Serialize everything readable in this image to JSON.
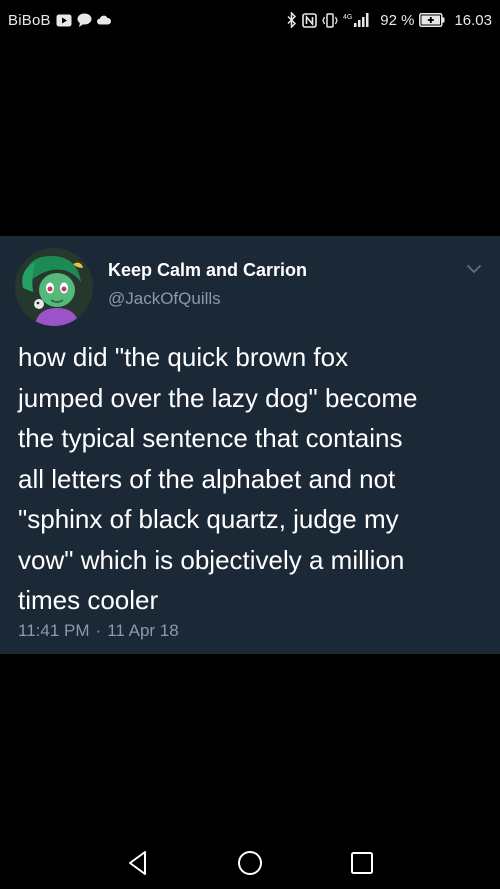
{
  "status_bar": {
    "carrier": "BiBoB",
    "network_label": "4G",
    "battery_percent": "92 %",
    "time": "16.03",
    "icons": [
      "video-icon",
      "chat-bubble-icon",
      "cloud-icon",
      "bluetooth-icon",
      "nfc-icon",
      "vibrate-icon",
      "signal-icon",
      "battery-icon"
    ]
  },
  "tweet": {
    "display_name": "Keep Calm and Carrion",
    "handle": "@JackOfQuills",
    "text": "how did \"the quick brown fox\njumped over the lazy dog\" become\nthe typical sentence that contains\nall letters of the alphabet and not\n\"sphinx of black quartz, judge my\nvow\" which is objectively a million\ntimes cooler",
    "time": "11:41 PM",
    "separator": "·",
    "date": "11 Apr 18"
  },
  "nav_bar": {
    "buttons": [
      "back-icon",
      "home-icon",
      "recents-icon"
    ]
  },
  "colors": {
    "background": "#000000",
    "card": "#1b2836",
    "secondary_text": "#8a9aa8",
    "primary_text": "#ffffff"
  }
}
